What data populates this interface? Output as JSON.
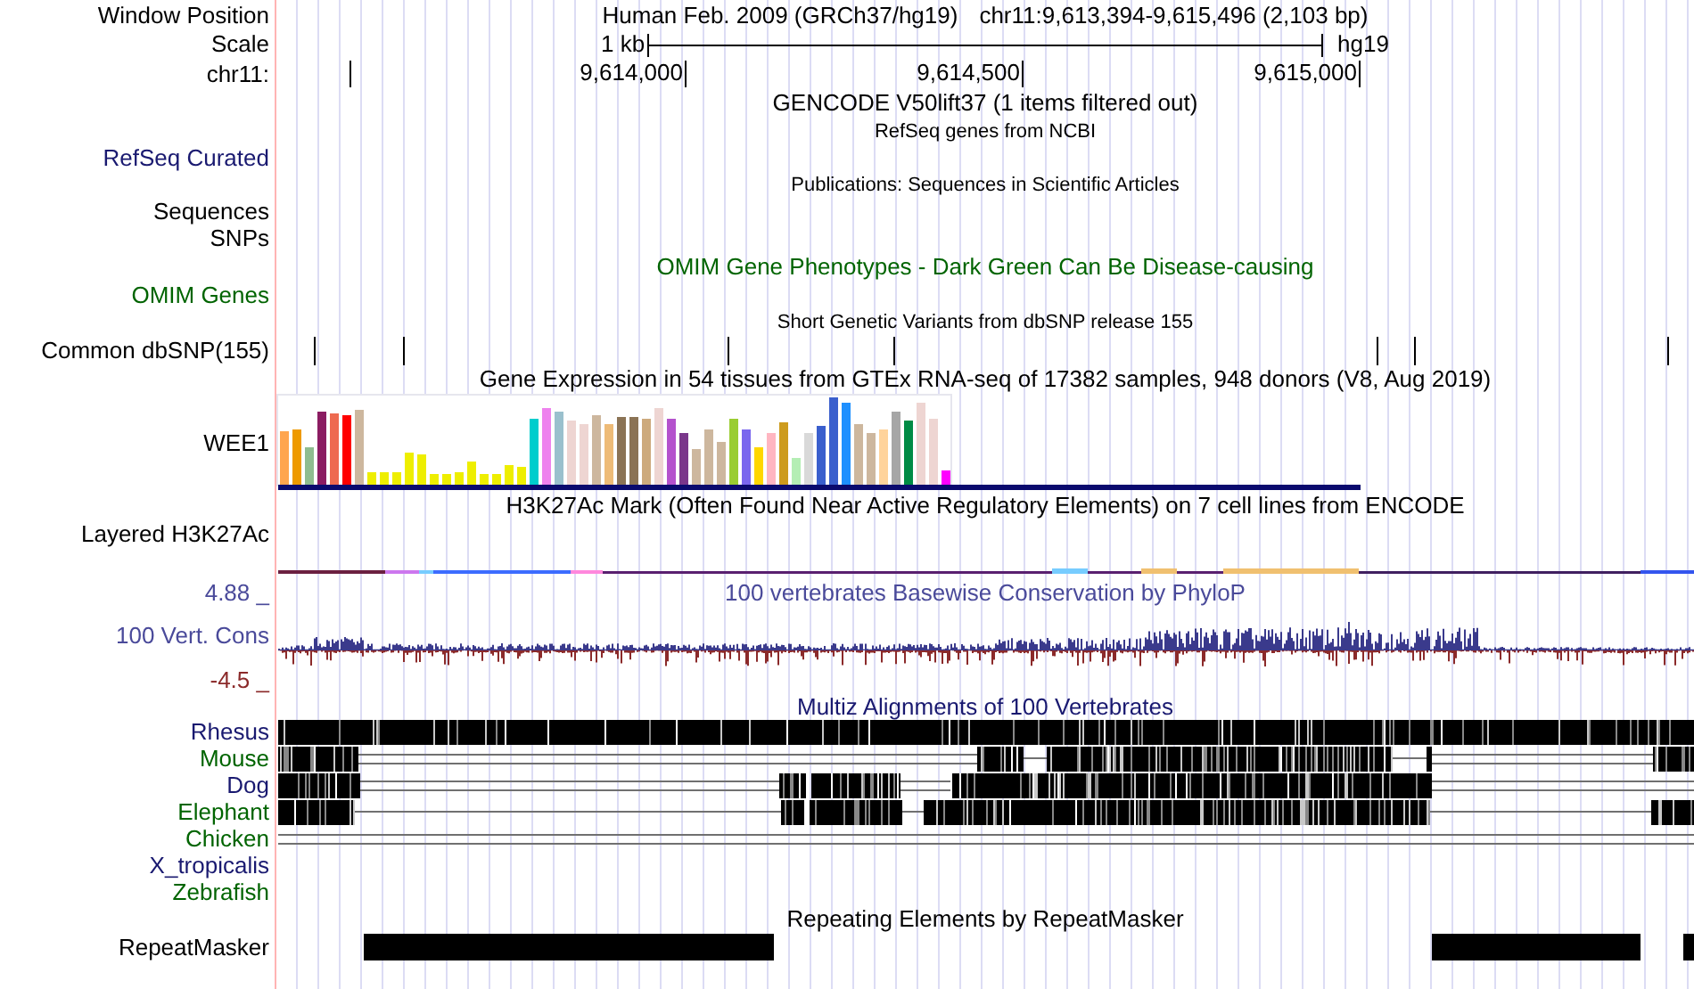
{
  "header": {
    "label": "Window Position",
    "assembly": "Human Feb. 2009 (GRCh37/hg19)",
    "position": "chr11:9,613,394-9,615,496 (2,103 bp)"
  },
  "scale": {
    "label": "Scale",
    "size": "1 kb",
    "assembly": "hg19"
  },
  "ruler": {
    "label": "chr11:",
    "ticks": [
      "9,614,000",
      "9,614,500",
      "9,615,000"
    ]
  },
  "gencode": {
    "title": "GENCODE V50lift37 (1 items filtered out)"
  },
  "refseq": {
    "title": "RefSeq genes from NCBI",
    "label": "RefSeq Curated"
  },
  "publications": {
    "title": "Publications: Sequences in Scientific Articles",
    "label": "Sequences"
  },
  "snps": {
    "label": "SNPs"
  },
  "omim": {
    "title": "OMIM Gene Phenotypes - Dark Green Can Be Disease-causing",
    "label": "OMIM Genes"
  },
  "dbsnp": {
    "title": "Short Genetic Variants from dbSNP release 155",
    "label": "Common dbSNP(155)"
  },
  "gtex": {
    "title": "Gene Expression in 54 tissues from GTEx RNA-seq of 17382 samples, 948 donors (V8, Aug 2019)",
    "gene": "WEE1"
  },
  "h3k27ac": {
    "title": "H3K27Ac Mark (Often Found Near Active Regulatory Elements) on 7 cell lines from ENCODE",
    "label": "Layered H3K27Ac"
  },
  "conservation": {
    "title": "100 vertebrates Basewise Conservation by PhyloP",
    "label": "100 Vert. Cons",
    "max": "4.88 _",
    "min": "-4.5 _"
  },
  "multiz": {
    "title": "Multiz Alignments of 100 Vertebrates",
    "species": [
      {
        "name": "Rhesus",
        "color": "#191970"
      },
      {
        "name": "Mouse",
        "color": "#006400"
      },
      {
        "name": "Dog",
        "color": "#191970"
      },
      {
        "name": "Elephant",
        "color": "#006400"
      },
      {
        "name": "Chicken",
        "color": "#006400"
      },
      {
        "name": "X_tropicalis",
        "color": "#191970"
      },
      {
        "name": "Zebrafish",
        "color": "#006400"
      }
    ]
  },
  "repeatmasker": {
    "title": "Repeating Elements by RepeatMasker",
    "label": "RepeatMasker"
  }
}
